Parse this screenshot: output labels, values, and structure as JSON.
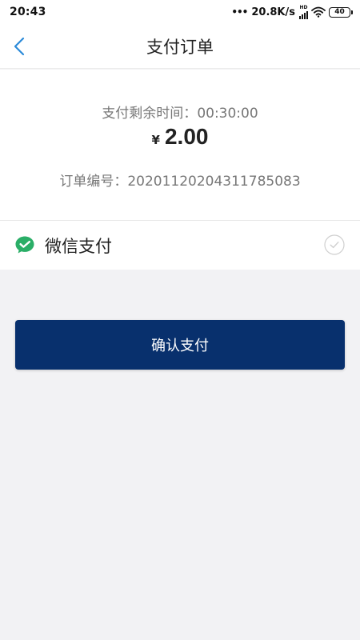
{
  "status_bar": {
    "time": "20:43",
    "dots": "•••",
    "network_speed": "20.8K/s",
    "hd_label": "HD",
    "battery_level": "40"
  },
  "header": {
    "title": "支付订单",
    "back_icon": "chevron-left-icon"
  },
  "order": {
    "countdown_label": "支付剩余时间：",
    "countdown_value": "00:30:00",
    "currency_symbol": "¥",
    "amount": "2.00",
    "order_number_label": "订单编号：",
    "order_number": "20201120204311785083"
  },
  "payment_method": {
    "label": "微信支付",
    "icon": "wechat-pay-icon",
    "selected_icon": "check-circle-icon"
  },
  "actions": {
    "confirm_label": "确认支付"
  },
  "colors": {
    "primary_button": "#08306d",
    "back_icon": "#2b8ad8",
    "wechat_green": "#2aae67",
    "page_background": "#f2f2f4"
  }
}
